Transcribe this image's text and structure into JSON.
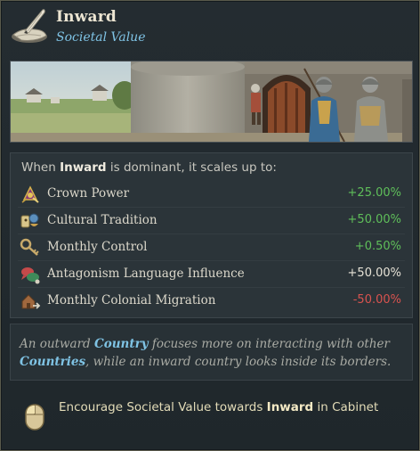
{
  "header": {
    "title": "Inward",
    "subtitle": "Societal Value",
    "icon": "quill-and-scroll-icon"
  },
  "effects": {
    "intro_prefix": "When ",
    "intro_value": "Inward",
    "intro_suffix": " is dominant, it scales up to:",
    "rows": [
      {
        "label": "Crown Power",
        "value": "+25.00%",
        "color": "#5fbf5a",
        "icon": "crown-power-icon"
      },
      {
        "label": "Cultural Tradition",
        "value": "+50.00%",
        "color": "#5fbf5a",
        "icon": "cultural-tradition-icon"
      },
      {
        "label": "Monthly Control",
        "value": "+0.50%",
        "color": "#5fbf5a",
        "icon": "key-control-icon"
      },
      {
        "label": "Antagonism Language Influence",
        "value": "+50.00%",
        "color": "#e6e2d6",
        "icon": "language-influence-icon"
      },
      {
        "label": "Monthly Colonial Migration",
        "value": "-50.00%",
        "color": "#d9534f",
        "icon": "colonial-migration-icon"
      }
    ]
  },
  "description": {
    "part1": "An outward ",
    "link1": "Country",
    "part2": " focuses more on interacting with other ",
    "link2": "Countries",
    "part3": ", while an inward country looks inside its borders."
  },
  "action": {
    "part1": "Encourage Societal Value towards ",
    "value": "Inward",
    "part2": " in Cabinet",
    "icon": "mouse-left-click-icon"
  }
}
